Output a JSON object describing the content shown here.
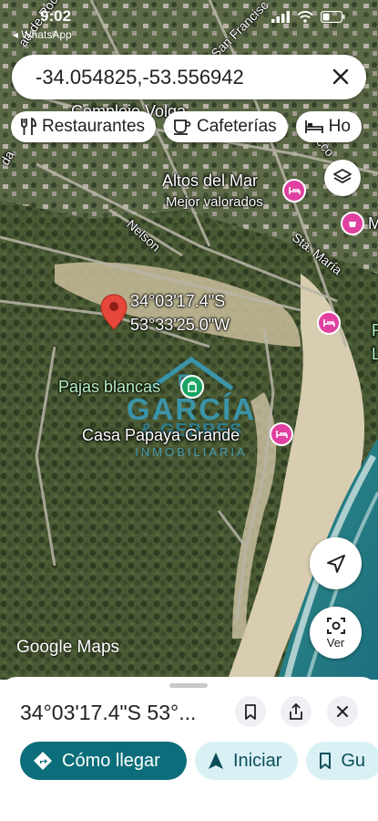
{
  "status": {
    "time": "9:02",
    "back_label": "◂ WhatsApp"
  },
  "search": {
    "value": "-34.054825,-53.556942"
  },
  "chips": [
    {
      "label": "Restaurantes",
      "icon": "fork-knife-icon"
    },
    {
      "label": "Cafeterías",
      "icon": "coffee-cup-icon"
    },
    {
      "label": "Ho",
      "icon": "bed-icon"
    }
  ],
  "map": {
    "streets": {
      "rocha": "ad de Roch",
      "san_francisco": "San Francisc",
      "nelson": "Nelson",
      "sta_maria": "Sta. María",
      "da": "da",
      "rocco": "occo"
    },
    "places": {
      "complejo": "Complejo Volga",
      "altos_del_mar": "Altos del Mar",
      "mejor_valorados": "Mejor valorados",
      "pajas_blancas": "Pajas blancas",
      "casa_papaya": "Casa Papaya Grande",
      "m_edge": "M",
      "p_edge": "P",
      "l_edge": "L"
    },
    "pin_lat": "34°03'17.4\"S",
    "pin_lon": "53°33'25.0\"W",
    "watermark": {
      "line1": "GARCÍA",
      "line2": "& GEBRES",
      "line3": "INMOBILIARIA"
    },
    "attribution": "Google Maps",
    "ver_label": "Ver"
  },
  "sheet": {
    "title": "34°03'17.4\"S 53°...",
    "directions_label": "Cómo llegar",
    "start_label": "Iniciar",
    "save_label": "Gu"
  },
  "colors": {
    "accent": "#0b6e7a",
    "pin": "#e5473b",
    "poi": "#e040a0"
  }
}
